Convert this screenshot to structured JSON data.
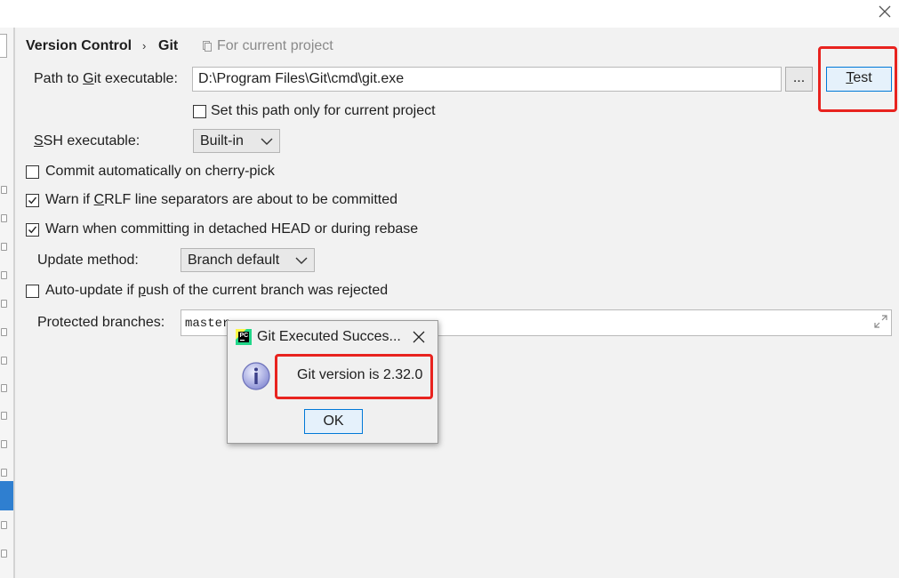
{
  "breadcrumb": {
    "root": "Version Control",
    "separator": "›",
    "current": "Git",
    "scope_note": "For current project"
  },
  "git_path": {
    "label_before": "Path to ",
    "label_underlined": "G",
    "label_after": "it executable:",
    "value": "D:\\Program Files\\Git\\cmd\\git.exe",
    "browse_label": "...",
    "test_underlined": "T",
    "test_rest": "est",
    "current_project_only_label": "Set this path only for current project",
    "current_project_only_checked": false
  },
  "ssh": {
    "label_underlined": "S",
    "label_rest": "SH executable:",
    "selected": "Built-in"
  },
  "options": {
    "cherry_pick": {
      "label": "Commit automatically on cherry-pick",
      "checked": false
    },
    "crlf": {
      "label_before": "Warn if ",
      "label_underlined": "C",
      "label_after": "RLF line separators are about to be committed",
      "checked": true
    },
    "detached_head": {
      "label": "Warn when committing in detached HEAD or during rebase",
      "checked": true
    },
    "auto_update": {
      "label_before": "Auto-update if ",
      "label_underlined": "p",
      "label_after": "ush of the current branch was rejected",
      "checked": false
    }
  },
  "update_method": {
    "label": "Update method:",
    "selected": "Branch default"
  },
  "protected_branches": {
    "label": "Protected branches:",
    "value": "master"
  },
  "dialog": {
    "title": "Git Executed Succes...",
    "message": "Git version is 2.32.0",
    "ok_label": "OK",
    "app_icon_text": "PC"
  },
  "colors": {
    "highlight_red": "#e8231f",
    "selection_blue": "#2f7fd0",
    "default_button_border": "#0078d7",
    "default_button_fill": "#e5f1fb"
  },
  "icons": [
    "close-icon",
    "copy-scope-icon",
    "chevron-down-icon",
    "expand-icon",
    "pycharm-icon",
    "info-icon",
    "check-icon"
  ]
}
